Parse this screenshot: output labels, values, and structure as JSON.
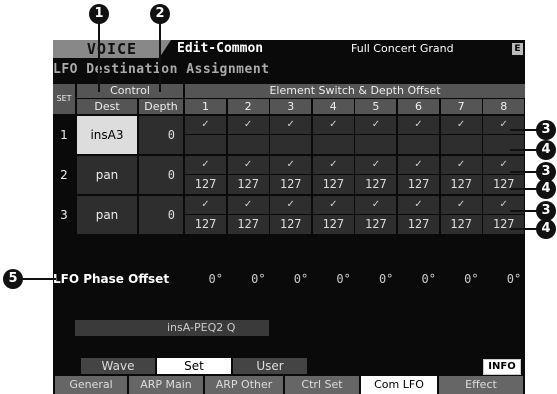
{
  "header": {
    "mode": "VOICE",
    "edit_title": "Edit-Common",
    "voice_name": "Full Concert Grand",
    "badge": "E"
  },
  "page_title": "LFO Destination Assignment",
  "table": {
    "set_header": "SET",
    "control_header": "Control",
    "dest_header": "Dest",
    "depth_header": "Depth",
    "element_header": "Element Switch & Depth Offset",
    "element_numbers": [
      "1",
      "2",
      "3",
      "4",
      "5",
      "6",
      "7",
      "8"
    ],
    "rows": [
      {
        "set": "1",
        "dest": "insA3",
        "depth": "0",
        "checks": [
          "✓",
          "✓",
          "✓",
          "✓",
          "✓",
          "✓",
          "✓",
          "✓"
        ],
        "offsets": [
          "",
          "",
          "",
          "",
          "",
          "",
          "",
          ""
        ]
      },
      {
        "set": "2",
        "dest": "pan",
        "depth": "0",
        "checks": [
          "✓",
          "✓",
          "✓",
          "✓",
          "✓",
          "✓",
          "✓",
          "✓"
        ],
        "offsets": [
          "127",
          "127",
          "127",
          "127",
          "127",
          "127",
          "127",
          "127"
        ]
      },
      {
        "set": "3",
        "dest": "pan",
        "depth": "0",
        "checks": [
          "✓",
          "✓",
          "✓",
          "✓",
          "✓",
          "✓",
          "✓",
          "✓"
        ],
        "offsets": [
          "127",
          "127",
          "127",
          "127",
          "127",
          "127",
          "127",
          "127"
        ]
      }
    ]
  },
  "lfo_phase": {
    "label": "LFO Phase Offset",
    "values": [
      "0°",
      "0°",
      "0°",
      "0°",
      "0°",
      "0°",
      "0°",
      "0°"
    ]
  },
  "info_text": "insA-PEQ2 Q",
  "tabs_top": [
    {
      "label": "Wave",
      "active": false
    },
    {
      "label": "Set",
      "active": true
    },
    {
      "label": "User",
      "active": false
    }
  ],
  "info_button": "INFO",
  "tabs_bottom": [
    {
      "label": "General"
    },
    {
      "label": "ARP Main"
    },
    {
      "label": "ARP Other"
    },
    {
      "label": "Ctrl Set"
    },
    {
      "label": "Com LFO",
      "active": true
    },
    {
      "label": "Effect"
    }
  ],
  "callouts": [
    "1",
    "2",
    "3",
    "4",
    "3",
    "4",
    "3",
    "4",
    "5"
  ]
}
